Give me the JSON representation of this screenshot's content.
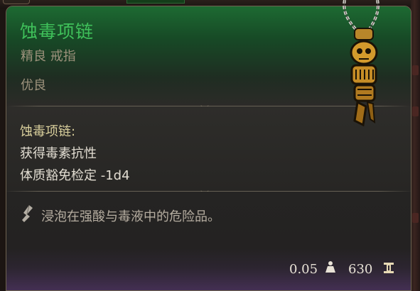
{
  "item": {
    "name": "蚀毒项链",
    "category": "精良 戒指",
    "rarity": "优良",
    "property_title": "蚀毒项链:",
    "properties": [
      "获得毒素抗性",
      "体质豁免检定 -1d4"
    ],
    "flavor_text": "浸泡在强酸与毒液中的危险品。",
    "weight": "0.05",
    "price": "630"
  },
  "icons": {
    "item_image": "poison-necklace-icon",
    "flavor": "feather-quill-icon",
    "weight": "weight-icon",
    "price": "gold-coin-icon"
  },
  "colors": {
    "name": "#3fc05a",
    "header_green": "#1d6a32",
    "muted_text": "#9d927c",
    "property_title": "#d9cf9c",
    "body_text": "#e2ddd2",
    "footer_purple": "#453055"
  }
}
